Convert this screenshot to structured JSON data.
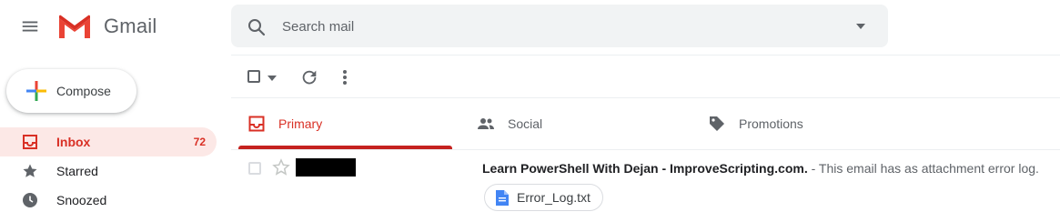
{
  "header": {
    "brand": "Gmail",
    "search_placeholder": "Search mail"
  },
  "sidebar": {
    "compose_label": "Compose",
    "items": [
      {
        "label": "Inbox",
        "count": "72",
        "active": true,
        "icon": "inbox-icon"
      },
      {
        "label": "Starred",
        "count": "",
        "active": false,
        "icon": "star-icon"
      },
      {
        "label": "Snoozed",
        "count": "",
        "active": false,
        "icon": "clock-icon"
      }
    ]
  },
  "tabs": [
    {
      "label": "Primary",
      "icon": "inbox-icon",
      "active": true
    },
    {
      "label": "Social",
      "icon": "people-icon",
      "active": false
    },
    {
      "label": "Promotions",
      "icon": "tag-icon",
      "active": false
    }
  ],
  "emails": [
    {
      "subject": "Learn PowerShell With Dejan - ImproveScripting.com.",
      "snippet": " - This email has as attachment error log.",
      "attachment": "Error_Log.txt"
    }
  ],
  "colors": {
    "accent": "#d93025",
    "active_bg": "#fce8e6"
  }
}
